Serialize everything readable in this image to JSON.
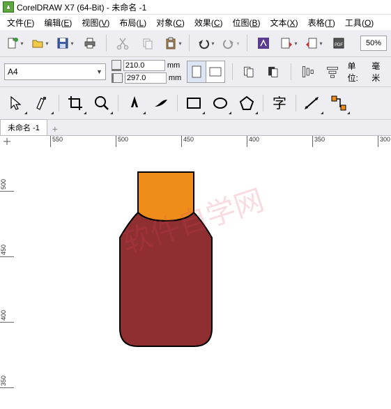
{
  "title": {
    "app": "CorelDRAW X7 (64-Bit)",
    "doc": "未命名 -1"
  },
  "menu": {
    "file": {
      "label": "文件",
      "key": "F"
    },
    "edit": {
      "label": "编辑",
      "key": "E"
    },
    "view": {
      "label": "视图",
      "key": "V"
    },
    "layout": {
      "label": "布局",
      "key": "L"
    },
    "object": {
      "label": "对象",
      "key": "C"
    },
    "effect": {
      "label": "效果",
      "key": "C"
    },
    "bitmap": {
      "label": "位图",
      "key": "B"
    },
    "text": {
      "label": "文本",
      "key": "X"
    },
    "table": {
      "label": "表格",
      "key": "T"
    },
    "tools": {
      "label": "工具",
      "key": "O"
    }
  },
  "toolbar": {
    "zoom": "50%"
  },
  "props": {
    "paper": "A4",
    "width": "210.0",
    "height": "297.0",
    "unit_mm": "mm",
    "units_label": "单位:",
    "units_value": "毫米"
  },
  "tabs": {
    "active": "未命名 -1"
  },
  "ruler_h": [
    "550",
    "500",
    "450",
    "400",
    "350",
    "300"
  ],
  "ruler_v": [
    "500",
    "450",
    "400",
    "350"
  ],
  "colors": {
    "cap": "#ee8d19",
    "body": "#8f2f31",
    "outline": "#000"
  }
}
